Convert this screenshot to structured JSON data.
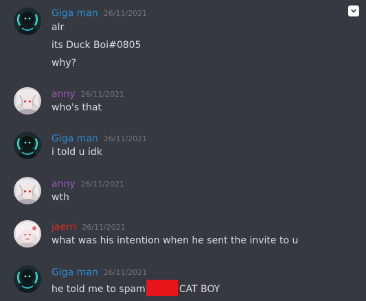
{
  "colors": {
    "background": "#36393f",
    "giga_man": "#2e8bd6",
    "anny": "#9b59b6",
    "jaerri": "#e02b2b",
    "text": "#dcddde",
    "timestamp": "#72767d",
    "redaction": "#e8161b"
  },
  "menu_icon": "chevron-down-icon",
  "messages": [
    {
      "author": "Giga man",
      "timestamp": "26/11/2021",
      "lines": [
        "alr",
        "its Duck Boi#0805",
        "why?"
      ]
    },
    {
      "author": "anny",
      "timestamp": "26/11/2021",
      "lines": [
        "who's that"
      ]
    },
    {
      "author": "Giga man",
      "timestamp": "26/11/2021",
      "lines": [
        "i told u idk"
      ]
    },
    {
      "author": "anny",
      "timestamp": "26/11/2021",
      "lines": [
        "wth"
      ]
    },
    {
      "author": "jaerri",
      "timestamp": "26/11/2021",
      "lines": [
        "what was his intention when he sent the invite to u"
      ]
    },
    {
      "author": "Giga man",
      "timestamp": "26/11/2021",
      "text_before_redaction": "he told me to spam",
      "text_after_redaction": "CAT BOY"
    }
  ]
}
